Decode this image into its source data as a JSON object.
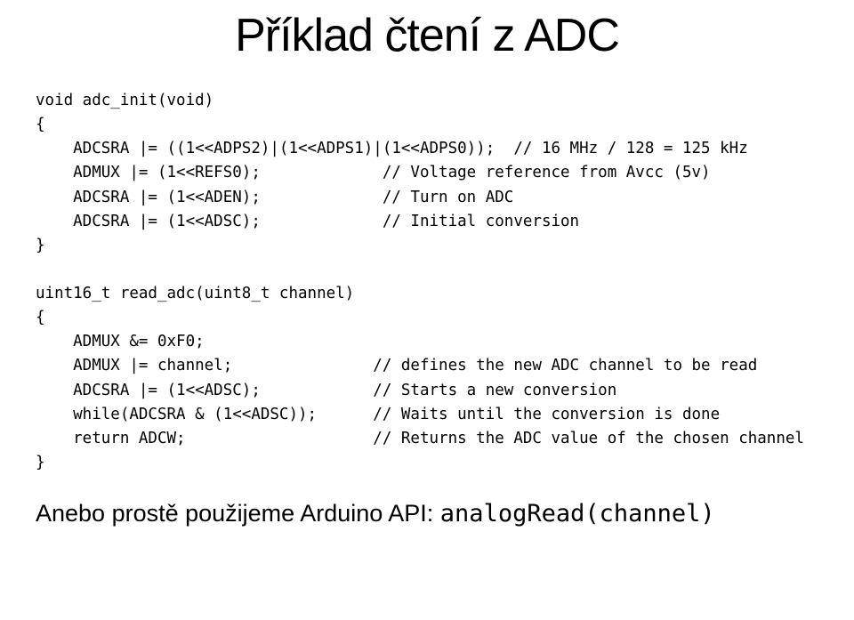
{
  "title": "Příklad čtení z ADC",
  "code": {
    "l01": "void adc_init(void)",
    "l02": "{",
    "l03": "    ADCSRA |= ((1<<ADPS2)|(1<<ADPS1)|(1<<ADPS0));  // 16 MHz / 128 = 125 kHz",
    "l04": "    ADMUX |= (1<<REFS0);             // Voltage reference from Avcc (5v)",
    "l05": "    ADCSRA |= (1<<ADEN);             // Turn on ADC",
    "l06": "    ADCSRA |= (1<<ADSC);             // Initial conversion",
    "l07": "}",
    "l08": "",
    "l09": "uint16_t read_adc(uint8_t channel)",
    "l10": "{",
    "l11": "    ADMUX &= 0xF0;",
    "l12": "    ADMUX |= channel;               // defines the new ADC channel to be read",
    "l13": "    ADCSRA |= (1<<ADSC);            // Starts a new conversion",
    "l14": "    while(ADCSRA & (1<<ADSC));      // Waits until the conversion is done",
    "l15": "    return ADCW;                    // Returns the ADC value of the chosen channel",
    "l16": "}"
  },
  "footer": {
    "text_prefix": "Anebo prostě použijeme Arduino API: ",
    "code": "analogRead(channel)"
  }
}
